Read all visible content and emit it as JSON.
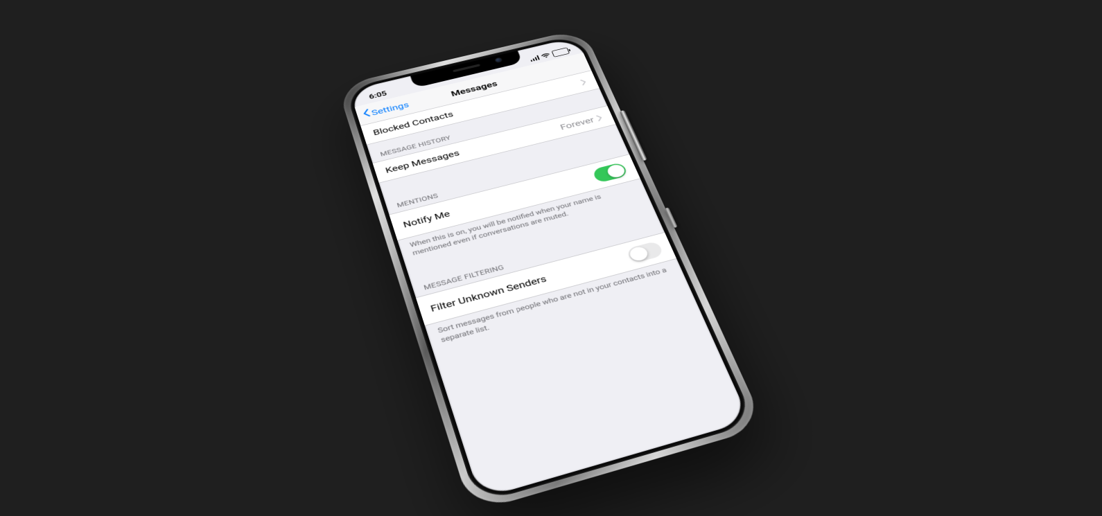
{
  "status": {
    "time": "6:05"
  },
  "navbar": {
    "back_label": "Settings",
    "title": "Messages"
  },
  "sections": {
    "blocked": {
      "label": "Blocked Contacts"
    },
    "history": {
      "header": "MESSAGE HISTORY",
      "keep_label": "Keep Messages",
      "keep_value": "Forever"
    },
    "mentions": {
      "header": "MENTIONS",
      "notify_label": "Notify Me",
      "notify_on": true,
      "footer": "When this is on, you will be notified when your name is mentioned even if conversations are muted."
    },
    "filtering": {
      "header": "MESSAGE FILTERING",
      "filter_label": "Filter Unknown Senders",
      "filter_on": false,
      "footer": "Sort messages from people who are not in your contacts into a separate list."
    }
  }
}
